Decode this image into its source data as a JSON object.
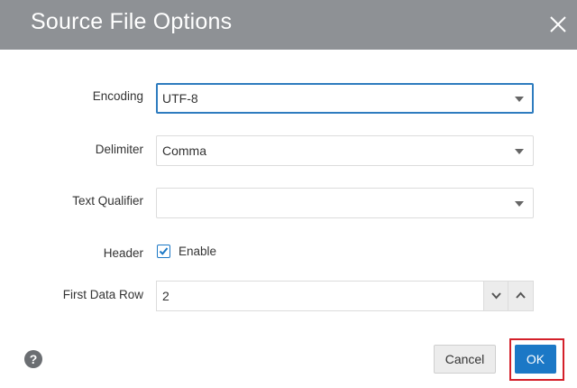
{
  "dialog": {
    "title": "Source File Options",
    "close_icon": "close-icon"
  },
  "form": {
    "encoding": {
      "label": "Encoding",
      "value": "UTF-8"
    },
    "delimiter": {
      "label": "Delimiter",
      "value": "Comma"
    },
    "text_qualifier": {
      "label": "Text Qualifier",
      "value": ""
    },
    "header": {
      "label": "Header",
      "checkbox_label": "Enable",
      "checked": true
    },
    "first_data_row": {
      "label": "First Data Row",
      "value": "2"
    }
  },
  "footer": {
    "help_glyph": "?",
    "cancel_label": "Cancel",
    "ok_label": "OK"
  },
  "colors": {
    "titlebar": "#8e9195",
    "accent": "#1b78c6",
    "highlight": "#d4202a"
  }
}
